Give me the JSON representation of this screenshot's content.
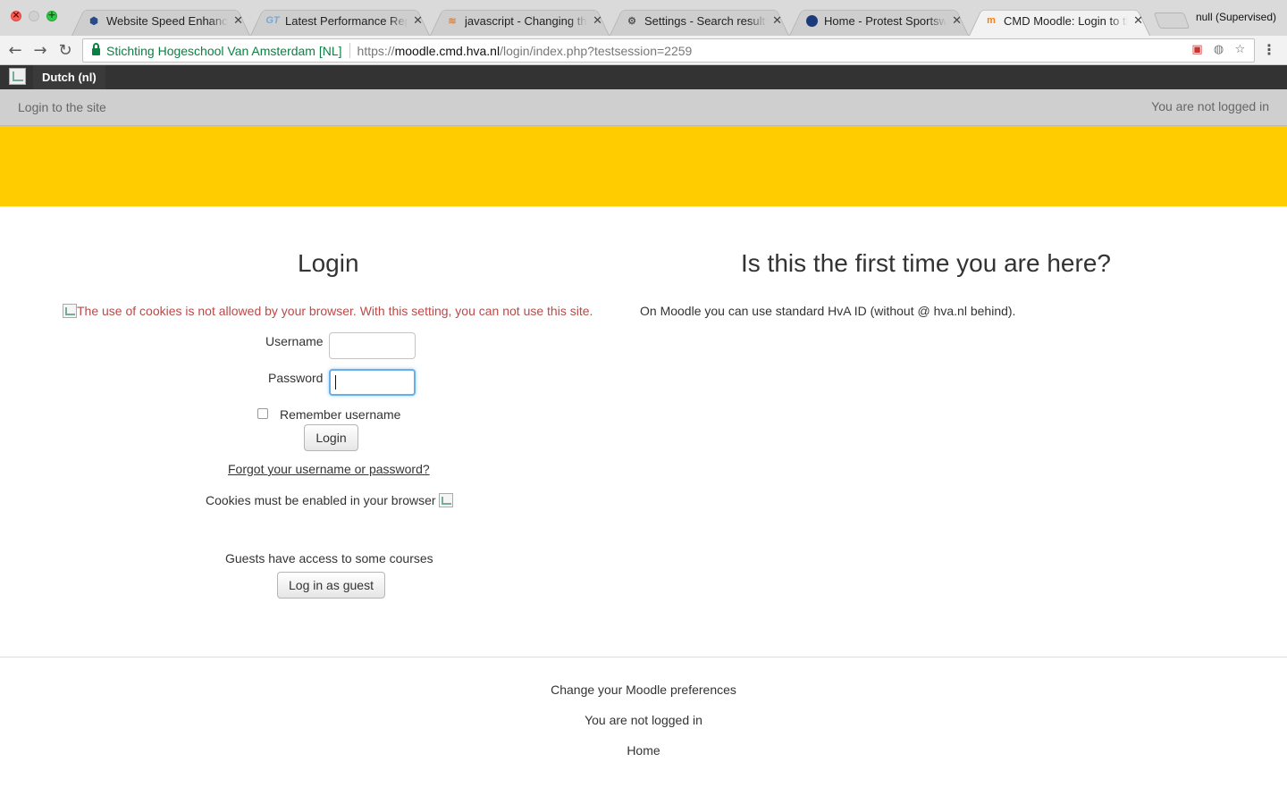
{
  "browser": {
    "tabs": [
      {
        "title": "Website Speed Enhancement",
        "icon": "cube-icon",
        "active": false
      },
      {
        "title": "Latest Performance Report",
        "icon": "gt-icon",
        "active": false
      },
      {
        "title": "javascript - Changing the",
        "icon": "stackoverflow-icon",
        "active": false
      },
      {
        "title": "Settings - Search results",
        "icon": "gear-icon",
        "active": false
      },
      {
        "title": "Home - Protest Sportswear",
        "icon": "protest-icon",
        "active": false
      },
      {
        "title": "CMD Moodle: Login to the site",
        "icon": "moodle-icon",
        "active": true
      }
    ],
    "profile": "null (Supervised)",
    "address": {
      "ev_label": "Stichting Hogeschool Van Amsterdam [NL]",
      "scheme": "https://",
      "host": "moodle.cmd.hva.nl",
      "path": "/login/index.php?testsession=2259"
    }
  },
  "navbar": {
    "language": "Dutch (nl)"
  },
  "header": {
    "breadcrumb": "Login to the site",
    "login_status": "You are not logged in"
  },
  "login": {
    "title": "Login",
    "cookie_warning": "The use of cookies is not allowed by your browser. With this setting, you can not use this site.",
    "username_label": "Username",
    "username_value": "",
    "password_label": "Password",
    "password_value": "",
    "remember_label": "Remember username",
    "remember_checked": false,
    "login_button": "Login",
    "forgot_link": "Forgot your username or password?",
    "cookies_note": "Cookies must be enabled in your browser",
    "guest_note": "Guests have access to some courses",
    "guest_button": "Log in as guest"
  },
  "first_time": {
    "title": "Is this the first time you are here?",
    "text": "On Moodle you can use standard HvA ID (without @ hva.nl behind)."
  },
  "footer": {
    "preferences_link": "Change your Moodle preferences",
    "login_status": "You are not logged in",
    "home_link": "Home"
  },
  "colors": {
    "banner": "#ffcc00",
    "navbar": "#333333",
    "warning": "#b94a48",
    "ev_green": "#0b8043"
  }
}
